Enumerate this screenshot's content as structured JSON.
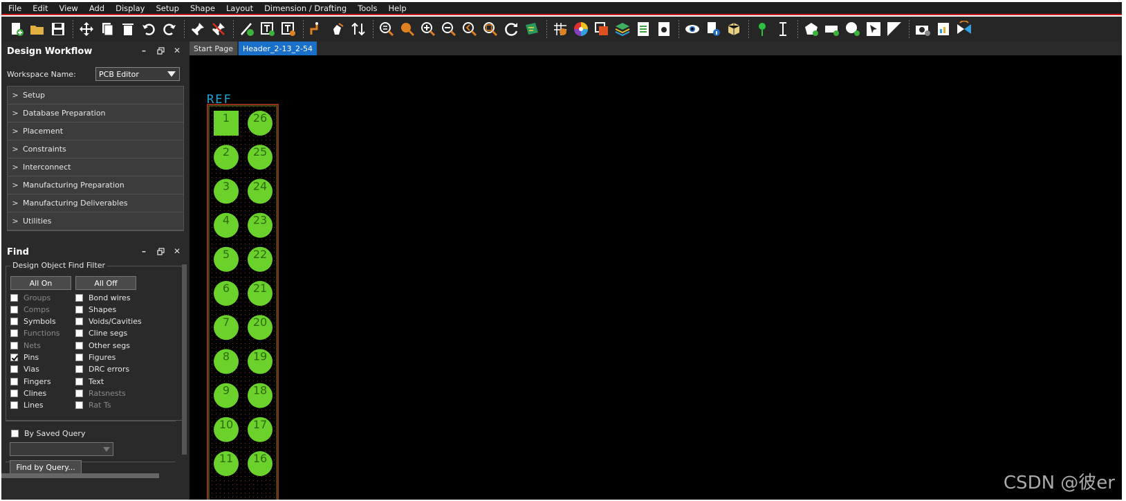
{
  "menu": [
    "File",
    "Edit",
    "View",
    "Add",
    "Display",
    "Setup",
    "Shape",
    "Layout",
    "Dimension / Drafting",
    "Tools",
    "Help"
  ],
  "toolbar_icons": [
    "new-icon",
    "open-icon",
    "save-icon",
    "sep",
    "move-icon",
    "copy-icon",
    "delete-icon",
    "undo-icon",
    "redo-icon",
    "sep",
    "pin-icon",
    "unpin-icon",
    "sep",
    "add-line-icon",
    "add-text-icon",
    "edit-text-icon",
    "sep",
    "route-icon",
    "slide-icon",
    "swap-icon",
    "sep",
    "zoom-fit-icon",
    "zoom-window-icon",
    "zoom-in-icon",
    "zoom-out-icon",
    "zoom-previous-icon",
    "zoom-world-icon",
    "redraw-icon",
    "pcb-3d-icon",
    "sep",
    "grid-icon",
    "color-icon",
    "shadow-icon",
    "layers-icon",
    "reports-icon",
    "settings-icon",
    "sep",
    "visibility-icon",
    "info-icon",
    "package-3d-icon",
    "sep",
    "marker-icon",
    "measure-icon",
    "sep",
    "shape-poly-icon",
    "shape-rect-icon",
    "shape-circle-icon",
    "select-shape-icon",
    "void-icon",
    "sep",
    "camera-icon",
    "export-icon",
    "flip-icon"
  ],
  "design_workflow": {
    "title": "Design Workflow",
    "workspace_label": "Workspace Name:",
    "workspace_value": "PCB Editor",
    "items": [
      "Setup",
      "Database Preparation",
      "Placement",
      "Constraints",
      "Interconnect",
      "Manufacturing Preparation",
      "Manufacturing Deliverables",
      "Utilities"
    ]
  },
  "find": {
    "title": "Find",
    "filter_title": "Design Object Find Filter",
    "all_on": "All On",
    "all_off": "All Off",
    "left_col": [
      {
        "label": "Groups",
        "checked": false,
        "dim": true
      },
      {
        "label": "Comps",
        "checked": false,
        "dim": true
      },
      {
        "label": "Symbols",
        "checked": false,
        "dim": false
      },
      {
        "label": "Functions",
        "checked": false,
        "dim": true
      },
      {
        "label": "Nets",
        "checked": false,
        "dim": true
      },
      {
        "label": "Pins",
        "checked": true,
        "dim": false
      },
      {
        "label": "Vias",
        "checked": false,
        "dim": false
      },
      {
        "label": "Fingers",
        "checked": false,
        "dim": false
      },
      {
        "label": "Clines",
        "checked": false,
        "dim": false
      },
      {
        "label": "Lines",
        "checked": false,
        "dim": false
      }
    ],
    "right_col": [
      {
        "label": "Bond wires",
        "checked": false,
        "dim": false
      },
      {
        "label": "Shapes",
        "checked": false,
        "dim": false
      },
      {
        "label": "Voids/Cavities",
        "checked": false,
        "dim": false
      },
      {
        "label": "Cline segs",
        "checked": false,
        "dim": false
      },
      {
        "label": "Other segs",
        "checked": false,
        "dim": false
      },
      {
        "label": "Figures",
        "checked": false,
        "dim": false
      },
      {
        "label": "DRC errors",
        "checked": false,
        "dim": false
      },
      {
        "label": "Text",
        "checked": false,
        "dim": false
      },
      {
        "label": "Ratsnests",
        "checked": false,
        "dim": true
      },
      {
        "label": "Rat Ts",
        "checked": false,
        "dim": true
      }
    ],
    "saved_query_label": "By Saved Query",
    "find_by_query": "Find by Query..."
  },
  "tabs": [
    {
      "label": "Start Page",
      "active": false
    },
    {
      "label": "Header_2-13_2-54",
      "active": true
    }
  ],
  "footprint": {
    "ref_label": "REF",
    "left_pins": [
      "1",
      "2",
      "3",
      "4",
      "5",
      "6",
      "7",
      "8",
      "9",
      "10",
      "11"
    ],
    "right_pins": [
      "26",
      "25",
      "24",
      "23",
      "22",
      "21",
      "20",
      "19",
      "18",
      "17",
      "16"
    ],
    "pad_color": "#6ad22a",
    "ref_color": "#1aa8d8",
    "outline_color": "#c83a1a"
  },
  "watermark": "CSDN @彼er",
  "colors": {
    "accent_red": "#c8201e",
    "tab_active": "#1a6fc8"
  }
}
